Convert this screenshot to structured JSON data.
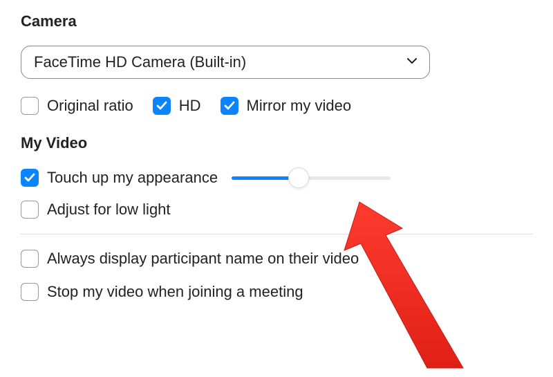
{
  "sections": {
    "camera": {
      "title": "Camera",
      "dropdown": {
        "selected": "FaceTime HD Camera (Built-in)"
      },
      "options": {
        "original_ratio": {
          "label": "Original ratio",
          "checked": false
        },
        "hd": {
          "label": "HD",
          "checked": true
        },
        "mirror": {
          "label": "Mirror my video",
          "checked": true
        }
      }
    },
    "my_video": {
      "title": "My Video",
      "touch_up": {
        "label": "Touch up my appearance",
        "checked": true,
        "slider_value": 0.42
      },
      "low_light": {
        "label": "Adjust for low light",
        "checked": false
      }
    },
    "extra": {
      "display_name": {
        "label": "Always display participant name on their video",
        "checked": false
      },
      "stop_video": {
        "label": "Stop my video when joining a meeting",
        "checked": false
      }
    }
  },
  "colors": {
    "accent": "#0a84ff",
    "annotation": "#ff3b30"
  }
}
